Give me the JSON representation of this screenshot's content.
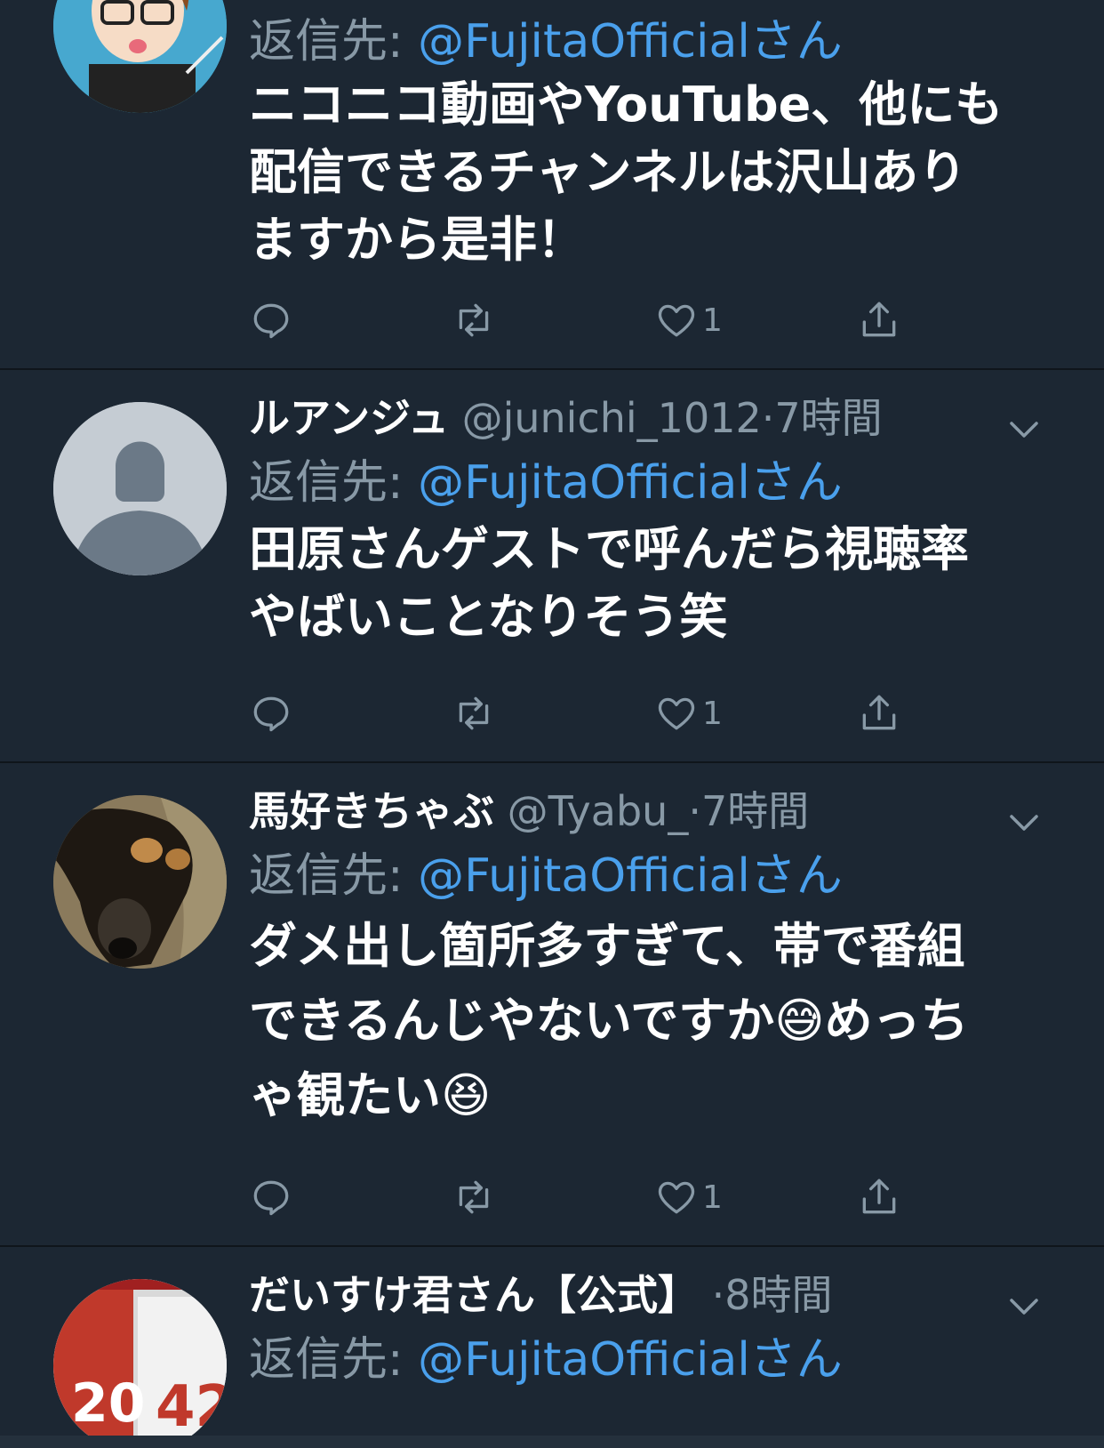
{
  "reply_label": "返信先:",
  "reply_to": "@FujitaOfficialさん",
  "tweets": [
    {
      "name": "",
      "handle": "",
      "time": "",
      "text": "ニコニコ動画やYouTube、他にも\n配信できるチャンネルは沢山あり\nますから是非！",
      "likes": "1",
      "avatar": "cartoon"
    },
    {
      "name": "ルアンジュ",
      "handle": "@junichi_1012",
      "time": "·7時間",
      "text": "田原さんゲストで呼んだら視聴率\nやばいことなりそう笑",
      "likes": "1",
      "avatar": "default"
    },
    {
      "name": "馬好きちゃぶ",
      "handle": "@Tyabu_",
      "time": "·7時間",
      "text": "ダメ出し箇所多すぎて、帯で番組\nできるんじやないですか😅めっち\nゃ観たい😆",
      "likes": "1",
      "avatar": "dog"
    },
    {
      "name": "だいすけ君さん【公式】",
      "handle": "",
      "time": "·8時間",
      "text": "",
      "likes": "",
      "avatar": "jersey"
    }
  ],
  "icons": {
    "reply": "reply-icon",
    "retweet": "retweet-icon",
    "like": "heart-icon",
    "share": "share-icon",
    "caret": "chevron-down-icon"
  },
  "colors": {
    "background": "#1c2733",
    "link": "#4aa0ec",
    "muted": "#8899a6"
  }
}
